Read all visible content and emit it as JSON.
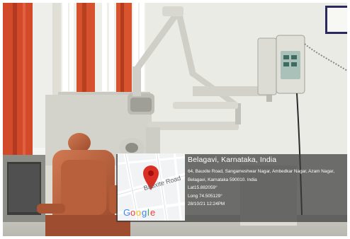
{
  "geo_stamp": {
    "title": "Belagavi, Karnataka, India",
    "address_line1": "64, Bauxite Road, Sangameshwar Nagar, Ambedkar Nagar, Azam Nagar,",
    "address_line2": "Belagavi, Karnataka 590010. India",
    "latitude": "Lat15.882059°",
    "longitude": "Long 74.505129°",
    "datetime": "28/10/21 12:24PM"
  },
  "map_thumbnail": {
    "street_label": "Bauxite Road",
    "brand": "Google",
    "brand_colors": [
      "#4285F4",
      "#EA4335",
      "#FBBC05",
      "#4285F4",
      "#34A853",
      "#EA4335"
    ],
    "pin_color": "#d93025",
    "pin_icon": "location-pin-icon"
  }
}
